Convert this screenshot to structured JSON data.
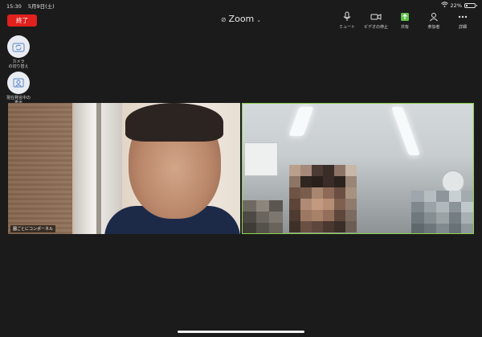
{
  "status": {
    "time": "15:30",
    "date": "5月9日(土)",
    "battery": "22%",
    "battery_level": 0.22
  },
  "header": {
    "end_label": "終了",
    "title": "Zoom"
  },
  "toolbar": [
    {
      "name": "mute",
      "label": "ミュート",
      "icon": "microphone-icon"
    },
    {
      "name": "stop-video",
      "label": "ビデオの停止",
      "icon": "video-camera-icon"
    },
    {
      "name": "share",
      "label": "共有",
      "icon": "share-icon"
    },
    {
      "name": "participants",
      "label": "参加者",
      "icon": "participants-icon"
    },
    {
      "name": "more",
      "label": "詳細",
      "icon": "more-icon"
    }
  ],
  "side_controls": {
    "switch_camera": "カメラ\nの切り替え",
    "active_speaker": "現在発言中の\n表示\nに切り替え"
  },
  "videos": {
    "left_name": "園ごとにコンポーネル"
  },
  "colors": {
    "background": "#1b1b1b",
    "end_button": "#e0211d",
    "share_green": "#5ec24b",
    "active_speaker_border": "#8fd14f"
  }
}
